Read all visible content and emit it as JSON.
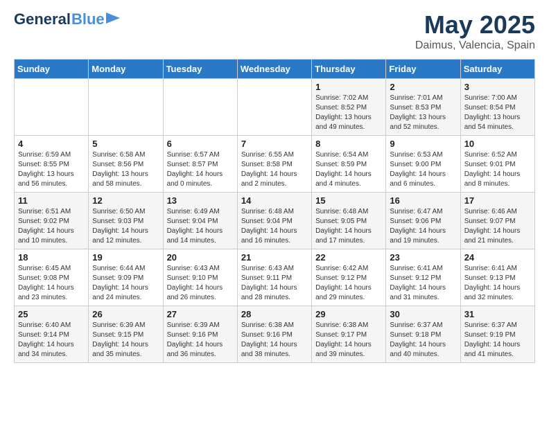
{
  "header": {
    "logo_general": "General",
    "logo_blue": "Blue",
    "month_year": "May 2025",
    "location": "Daimus, Valencia, Spain"
  },
  "weekdays": [
    "Sunday",
    "Monday",
    "Tuesday",
    "Wednesday",
    "Thursday",
    "Friday",
    "Saturday"
  ],
  "weeks": [
    [
      {
        "day": "",
        "info": ""
      },
      {
        "day": "",
        "info": ""
      },
      {
        "day": "",
        "info": ""
      },
      {
        "day": "",
        "info": ""
      },
      {
        "day": "1",
        "info": "Sunrise: 7:02 AM\nSunset: 8:52 PM\nDaylight: 13 hours\nand 49 minutes."
      },
      {
        "day": "2",
        "info": "Sunrise: 7:01 AM\nSunset: 8:53 PM\nDaylight: 13 hours\nand 52 minutes."
      },
      {
        "day": "3",
        "info": "Sunrise: 7:00 AM\nSunset: 8:54 PM\nDaylight: 13 hours\nand 54 minutes."
      }
    ],
    [
      {
        "day": "4",
        "info": "Sunrise: 6:59 AM\nSunset: 8:55 PM\nDaylight: 13 hours\nand 56 minutes."
      },
      {
        "day": "5",
        "info": "Sunrise: 6:58 AM\nSunset: 8:56 PM\nDaylight: 13 hours\nand 58 minutes."
      },
      {
        "day": "6",
        "info": "Sunrise: 6:57 AM\nSunset: 8:57 PM\nDaylight: 14 hours\nand 0 minutes."
      },
      {
        "day": "7",
        "info": "Sunrise: 6:55 AM\nSunset: 8:58 PM\nDaylight: 14 hours\nand 2 minutes."
      },
      {
        "day": "8",
        "info": "Sunrise: 6:54 AM\nSunset: 8:59 PM\nDaylight: 14 hours\nand 4 minutes."
      },
      {
        "day": "9",
        "info": "Sunrise: 6:53 AM\nSunset: 9:00 PM\nDaylight: 14 hours\nand 6 minutes."
      },
      {
        "day": "10",
        "info": "Sunrise: 6:52 AM\nSunset: 9:01 PM\nDaylight: 14 hours\nand 8 minutes."
      }
    ],
    [
      {
        "day": "11",
        "info": "Sunrise: 6:51 AM\nSunset: 9:02 PM\nDaylight: 14 hours\nand 10 minutes."
      },
      {
        "day": "12",
        "info": "Sunrise: 6:50 AM\nSunset: 9:03 PM\nDaylight: 14 hours\nand 12 minutes."
      },
      {
        "day": "13",
        "info": "Sunrise: 6:49 AM\nSunset: 9:04 PM\nDaylight: 14 hours\nand 14 minutes."
      },
      {
        "day": "14",
        "info": "Sunrise: 6:48 AM\nSunset: 9:04 PM\nDaylight: 14 hours\nand 16 minutes."
      },
      {
        "day": "15",
        "info": "Sunrise: 6:48 AM\nSunset: 9:05 PM\nDaylight: 14 hours\nand 17 minutes."
      },
      {
        "day": "16",
        "info": "Sunrise: 6:47 AM\nSunset: 9:06 PM\nDaylight: 14 hours\nand 19 minutes."
      },
      {
        "day": "17",
        "info": "Sunrise: 6:46 AM\nSunset: 9:07 PM\nDaylight: 14 hours\nand 21 minutes."
      }
    ],
    [
      {
        "day": "18",
        "info": "Sunrise: 6:45 AM\nSunset: 9:08 PM\nDaylight: 14 hours\nand 23 minutes."
      },
      {
        "day": "19",
        "info": "Sunrise: 6:44 AM\nSunset: 9:09 PM\nDaylight: 14 hours\nand 24 minutes."
      },
      {
        "day": "20",
        "info": "Sunrise: 6:43 AM\nSunset: 9:10 PM\nDaylight: 14 hours\nand 26 minutes."
      },
      {
        "day": "21",
        "info": "Sunrise: 6:43 AM\nSunset: 9:11 PM\nDaylight: 14 hours\nand 28 minutes."
      },
      {
        "day": "22",
        "info": "Sunrise: 6:42 AM\nSunset: 9:12 PM\nDaylight: 14 hours\nand 29 minutes."
      },
      {
        "day": "23",
        "info": "Sunrise: 6:41 AM\nSunset: 9:12 PM\nDaylight: 14 hours\nand 31 minutes."
      },
      {
        "day": "24",
        "info": "Sunrise: 6:41 AM\nSunset: 9:13 PM\nDaylight: 14 hours\nand 32 minutes."
      }
    ],
    [
      {
        "day": "25",
        "info": "Sunrise: 6:40 AM\nSunset: 9:14 PM\nDaylight: 14 hours\nand 34 minutes."
      },
      {
        "day": "26",
        "info": "Sunrise: 6:39 AM\nSunset: 9:15 PM\nDaylight: 14 hours\nand 35 minutes."
      },
      {
        "day": "27",
        "info": "Sunrise: 6:39 AM\nSunset: 9:16 PM\nDaylight: 14 hours\nand 36 minutes."
      },
      {
        "day": "28",
        "info": "Sunrise: 6:38 AM\nSunset: 9:16 PM\nDaylight: 14 hours\nand 38 minutes."
      },
      {
        "day": "29",
        "info": "Sunrise: 6:38 AM\nSunset: 9:17 PM\nDaylight: 14 hours\nand 39 minutes."
      },
      {
        "day": "30",
        "info": "Sunrise: 6:37 AM\nSunset: 9:18 PM\nDaylight: 14 hours\nand 40 minutes."
      },
      {
        "day": "31",
        "info": "Sunrise: 6:37 AM\nSunset: 9:19 PM\nDaylight: 14 hours\nand 41 minutes."
      }
    ]
  ]
}
